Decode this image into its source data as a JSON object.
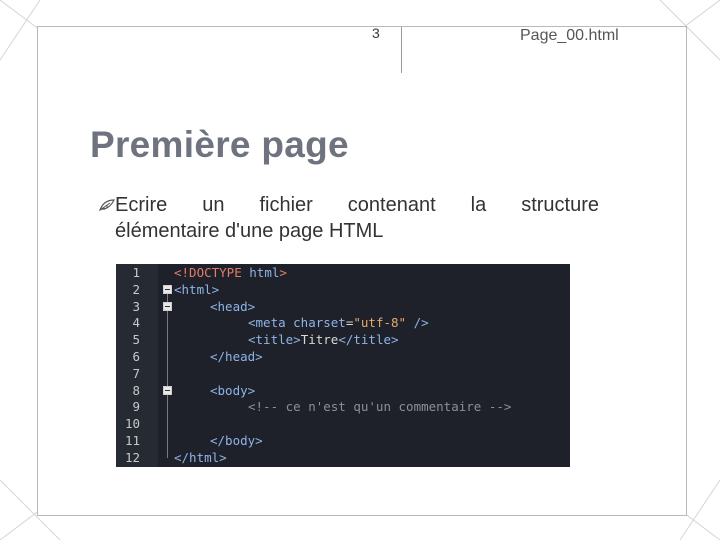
{
  "header": {
    "slide_number": "3",
    "page_name": "Page_00.html"
  },
  "title": "Première page",
  "bullet": {
    "icon": "leaf-bullet-icon",
    "line1": "Ecrire un fichier contenant la structure",
    "line2": "élémentaire d'une page HTML"
  },
  "code": {
    "line_numbers": [
      "1",
      "2",
      "3",
      "4",
      "5",
      "6",
      "7",
      "8",
      "9",
      "10",
      "11",
      "12"
    ],
    "lines": [
      {
        "p1": "<!DOCTYPE ",
        "p2": "html",
        "p3": ">"
      },
      {
        "p1": "<html>"
      },
      {
        "p1": "<head>"
      },
      {
        "p1": "<meta ",
        "p2": "charset",
        "p3": "=",
        "p4": "\"utf-8\"",
        "p5": " />"
      },
      {
        "p1": "<title>",
        "p2": "Titre",
        "p3": "</title>"
      },
      {
        "p1": "</head>"
      },
      {
        "p1": ""
      },
      {
        "p1": "<body>"
      },
      {
        "p1": "<!-- ce n'est qu'un commentaire -->"
      },
      {
        "p1": ""
      },
      {
        "p1": "</body>"
      },
      {
        "p1": "</html>"
      }
    ]
  },
  "colors": {
    "title": "#6f7380",
    "code_bg": "#1e2129",
    "tag": "#8fb3e8",
    "string": "#e6a86c",
    "doctype": "#e27d6a"
  }
}
